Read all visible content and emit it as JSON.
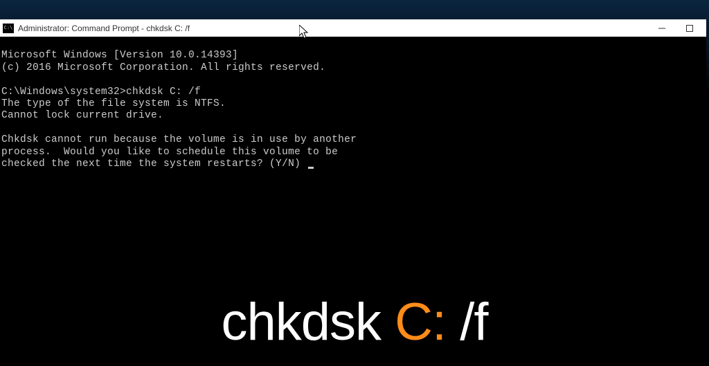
{
  "window": {
    "title": "Administrator: Command Prompt - chkdsk  C: /f"
  },
  "terminal": {
    "line1": "Microsoft Windows [Version 10.0.14393]",
    "line2": "(c) 2016 Microsoft Corporation. All rights reserved.",
    "blank1": "",
    "prompt_line": "C:\\Windows\\system32>chkdsk C: /f",
    "line3": "The type of the file system is NTFS.",
    "line4": "Cannot lock current drive.",
    "blank2": "",
    "line5": "Chkdsk cannot run because the volume is in use by another",
    "line6": "process.  Would you like to schedule this volume to be",
    "line7": "checked the next time the system restarts? (Y/N) "
  },
  "caption": {
    "part1": "chkdsk ",
    "part2": "C:",
    "part3": " /f"
  },
  "colors": {
    "accent": "#ff8c1a"
  }
}
